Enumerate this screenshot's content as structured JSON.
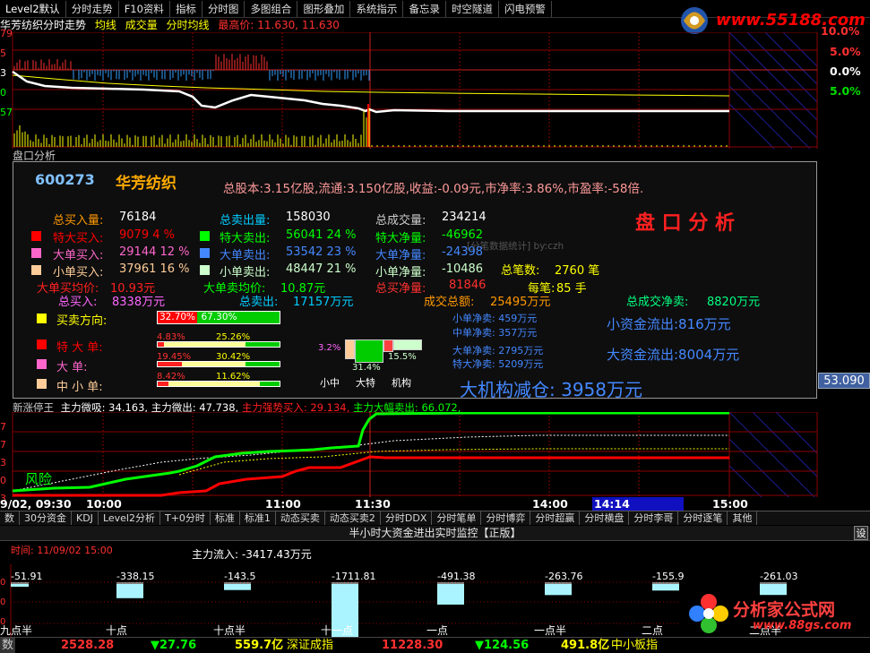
{
  "menu": [
    "Level2默认",
    "分时走势",
    "F10资料",
    "指标",
    "分时图",
    "多图组合",
    "图形叠加",
    "系统指示",
    "备忘录",
    "时空隧道",
    "闪电预警"
  ],
  "logo_top": {
    "url": "www.55188.com"
  },
  "title": {
    "name": "华芳纺织分时走势",
    "ma": "均线",
    "vol": "成交量",
    "line": "分时均线",
    "high_label": "最高价: 11.630, 11.630"
  },
  "left_axis_top": [
    "79",
    "5",
    "3",
    "0",
    "57"
  ],
  "pct_labels": [
    {
      "text": "10.0%",
      "color": "#ff3030"
    },
    {
      "text": "5.0%",
      "color": "#ff3030"
    },
    {
      "text": "0.0%",
      "color": "#ffffff"
    },
    {
      "text": "5.0%",
      "color": "#00e000"
    }
  ],
  "price_box": "53.090",
  "panel": {
    "title": "盘口分析",
    "code": "600273",
    "name": "华芳纺织",
    "info": "总股本:3.15亿股,流通:3.150亿股,收益:-0.09元,市净率:3.86%,市盈率:-58倍.",
    "big_title": "盘 口 分 析",
    "watermark": "[分笔数据统计] by:czh",
    "buy_total_label": "总买入量:",
    "buy_total": "76184",
    "sell_total_label": "总卖出量:",
    "sell_total": "158030",
    "vol_total_label": "总成交量:",
    "vol_total": "234214",
    "rows": [
      {
        "color": "#ff0000",
        "buy_label": "特大买入:",
        "buy": "9079  4 %",
        "sell_color": "#00ff00",
        "sell_label": "特大卖出:",
        "sell": "56041 24 %",
        "net_label": "特大净量:",
        "net": "-46962"
      },
      {
        "color": "#ff66cc",
        "buy_label": "大单买入:",
        "buy": "29144 12 %",
        "sell_color": "#4488ff",
        "sell_label": "大单卖出:",
        "sell": "53542 23 %",
        "net_label": "大单净量:",
        "net": "-24398"
      },
      {
        "color": "#ffcc99",
        "buy_label": "小单买入:",
        "buy": "37961 16 %",
        "sell_color": "#ccffcc",
        "sell_label": "小单卖出:",
        "sell": "48447 21 %",
        "net_label": "小单净量:",
        "net": "-10486"
      }
    ],
    "buy_avg_label": "大单买均价:",
    "buy_avg": "10.93元",
    "sell_avg_label": "大单卖均价:",
    "sell_avg": "10.87元",
    "total_net_label": "总买净量:",
    "total_net": "81846",
    "total_bi_label": "总笔数:",
    "total_bi": "2760 笔",
    "per_bi_label": "每笔:",
    "per_bi": "85 手",
    "buy_amt_label": "总买入:",
    "buy_amt": "8338万元",
    "sell_amt_label": "总卖出:",
    "sell_amt": "17157万元",
    "deal_amt_label": "成交总额:",
    "deal_amt": "25495万元",
    "net_amt_label": "总成交净卖:",
    "net_amt": "8820万元",
    "dir_label": "买卖方向:",
    "dir_buy": "32.70%",
    "dir_sell": "67.30%",
    "dir_buy_frac": 0.327,
    "bars": [
      {
        "label": "特 大 单:",
        "color": "#ff0000",
        "a": "4.83%",
        "b": "25.26%",
        "af": 0.05,
        "bf": 0.72
      },
      {
        "label": "大    单:",
        "color": "#ff66cc",
        "a": "19.45%",
        "b": "30.42%",
        "af": 0.2,
        "bf": 0.72
      },
      {
        "label": "中 小 单:",
        "color": "#ffcc99",
        "a": "8.42%",
        "b": "11.62%",
        "af": 0.09,
        "bf": 0.84
      }
    ],
    "mini": {
      "left": "3.2%",
      "mid": "31.4%",
      "right": "15.5%",
      "cap1": "小中",
      "cap2": "大特",
      "cap3": "机构"
    },
    "small_net_sell": "小单净卖: 459万元",
    "mid_net_sell": "中单净卖: 357万元",
    "big_net_sell": "大单净卖: 2795万元",
    "huge_net_sell": "特大净卖: 5209万元",
    "small_flow": "小资金流出:816万元",
    "big_flow": "大资金流出:8004万元",
    "conclusion": "大机构减仓: 3958万元"
  },
  "sub_title": {
    "name": "新涨停王",
    "a": "主力微吸: 34.163,",
    "b": "主力微出: 47.738,",
    "c": "主力强势买入: 29.134,",
    "d": "主力大幅卖出: 66.072,"
  },
  "sub_left_axis": [
    "7",
    "7",
    "3",
    "0",
    "3"
  ],
  "risk_label": "风险",
  "time_axis": {
    "date": "9/02, 09:30",
    "t1": "10:00",
    "t2": "11:00",
    "t3": "11:30",
    "t4": "14:00",
    "t5": "14:14",
    "t6": "15:00"
  },
  "tabs": [
    "数",
    "30分资金",
    "KDJ",
    "Level2分析",
    "T+0分时",
    "标准",
    "标准1",
    "动态买卖",
    "动态买卖2",
    "分时DDX",
    "分时笔单",
    "分时博弈",
    "分时超赢",
    "分时横盘",
    "分时李哥",
    "分时逐笔",
    "其他"
  ],
  "monitor_title": "半小时大资金进出实时监控【正版】",
  "settings_btn": "设",
  "monitor_time": "时间: 11/09/02 15:00",
  "monitor_flow": "主力流入: -3417.43万元",
  "bars_bottom": [
    {
      "v": "-51.91",
      "lab": "九点半"
    },
    {
      "v": "-338.15",
      "lab": "十点"
    },
    {
      "v": "-143.5",
      "lab": "十点半"
    },
    {
      "v": "-1711.81",
      "lab": "十一点"
    },
    {
      "v": "-491.38",
      "lab": "一点"
    },
    {
      "v": "-263.76",
      "lab": "一点半"
    },
    {
      "v": "-155.9",
      "lab": "二点"
    },
    {
      "v": "-261.03",
      "lab": "二点半"
    }
  ],
  "left_axis_bottom": [
    "0",
    "0",
    "0"
  ],
  "logo_bottom": {
    "name": "分析家公式网",
    "url": "www.88gs.com"
  },
  "status": {
    "s1": "数",
    "v1": "2528.28",
    "c1": "▼27.76",
    "a1": "559.7亿",
    "n2": "深证成指",
    "v2": "11228.30",
    "c2": "▼124.56",
    "a2": "491.8亿",
    "n3": "中小板指"
  }
}
